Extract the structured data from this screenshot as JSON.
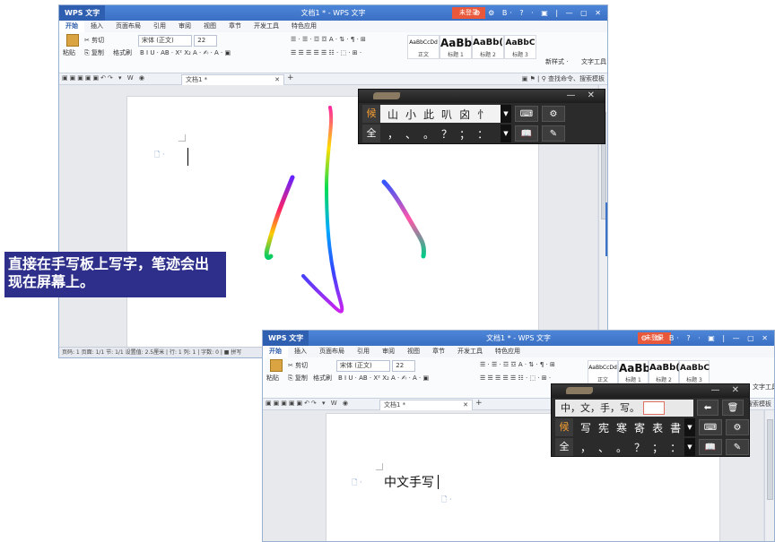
{
  "app": {
    "menu_label": "WPS 文字",
    "doc_title": "文档1 * - WPS 文字",
    "login_label": "未登录",
    "window_controls": "⚙ ⚙ B· ? · ▣ | — ▢ ✕"
  },
  "tabs": [
    "开始",
    "插入",
    "页面布局",
    "引用",
    "审阅",
    "视图",
    "章节",
    "开发工具",
    "特色应用"
  ],
  "ribbon": {
    "paste": "粘贴",
    "cut": "剪切",
    "copy": "复制",
    "format_painter": "格式刷",
    "font_name": "宋体 (正文)",
    "font_size": "22",
    "format_row": "B  I  U · AB · X² X₂  A · ✍ · A · ▣",
    "para_row_top": "☰ · ☰ · ☲ ☲  A · ⇅ · ¶ · ⊞",
    "para_row_bottom": "☰ ☰ ☰ ☰ ☰  ☷ · ⬚ · ⊞ ·",
    "styles": [
      {
        "preview": "AaBbCcDd",
        "label": "正文"
      },
      {
        "preview": "AaBb",
        "label": "标题 1"
      },
      {
        "preview": "AaBb(",
        "label": "标题 2"
      },
      {
        "preview": "AaBbC",
        "label": "标题 3"
      }
    ],
    "new_style": "新样式 ·",
    "text_tools": "文字工具"
  },
  "quick": {
    "doc_tab": "文档1 *",
    "search": "▣ ⚑ | ⚲ 查找命令、搜索模板"
  },
  "statusbar": "页码: 1   页面: 1/1   节: 1/1   设置值: 2.5厘米 | 行: 1   列: 1 | 字数: 0 | ■ 拼写",
  "callout": "直接在手写板上写字，笔迹会出现在屏幕上。",
  "ime_top": {
    "row1_tag": "候",
    "row1_candidates": [
      "山",
      "小",
      "此",
      "叭",
      "囟",
      "忄"
    ],
    "row2_tag": "全",
    "row2_punct": [
      "，",
      "、",
      "。",
      "？",
      "；",
      "："
    ]
  },
  "ime_bottom": {
    "input_chars": "中，文，手，写。",
    "row1_tag": "候",
    "row1_candidates": [
      "写",
      "宪",
      "寒",
      "寄",
      "表",
      "書"
    ],
    "row2_tag": "全",
    "row2_punct": [
      "，",
      "、",
      "。",
      "？",
      "；",
      "："
    ]
  },
  "typed_text": "中文手写",
  "colors": {
    "title_bar": "#3a6fc4",
    "login_button": "#e9583a",
    "callout_bg": "#2e2f8a",
    "ime_bg": "#2b2b2b"
  }
}
